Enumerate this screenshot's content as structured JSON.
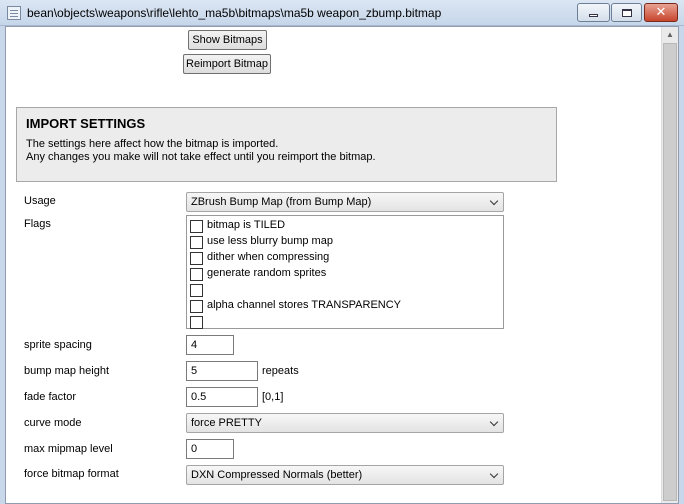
{
  "window": {
    "title": "bean\\objects\\weapons\\rifle\\lehto_ma5b\\bitmaps\\ma5b weapon_zbump.bitmap"
  },
  "buttons": {
    "show_bitmaps": "Show Bitmaps",
    "reimport_bitmap": "Reimport Bitmap"
  },
  "import_settings": {
    "title": "IMPORT SETTINGS",
    "desc_line1": "The settings here affect how the bitmap is imported.",
    "desc_line2": "Any changes you make will not take effect until you reimport the bitmap."
  },
  "fields": {
    "usage": {
      "label": "Usage",
      "value": "ZBrush Bump Map (from Bump Map)"
    },
    "flags": {
      "label": "Flags",
      "items": [
        {
          "label": "bitmap is TILED",
          "checked": false
        },
        {
          "label": "use less blurry bump map",
          "checked": false
        },
        {
          "label": "dither when compressing",
          "checked": false
        },
        {
          "label": "generate random sprites",
          "checked": false
        },
        {
          "label": "",
          "checked": false
        },
        {
          "label": "alpha channel stores TRANSPARENCY",
          "checked": false
        },
        {
          "label": "",
          "checked": false
        }
      ]
    },
    "sprite_spacing": {
      "label": "sprite spacing",
      "value": "4"
    },
    "bump_map_height": {
      "label": "bump map height",
      "value": "5",
      "unit": "repeats"
    },
    "fade_factor": {
      "label": "fade factor",
      "value": "0.5",
      "unit": "[0,1]"
    },
    "curve_mode": {
      "label": "curve mode",
      "value": "force PRETTY"
    },
    "max_mipmap_level": {
      "label": "max mipmap level",
      "value": "0"
    },
    "force_bitmap_format": {
      "label": "force bitmap format",
      "value": "DXN Compressed Normals (better)"
    }
  },
  "icons": {
    "app": "document-icon",
    "minimize": "minimize-icon",
    "maximize": "maximize-icon",
    "close": "close-icon",
    "dropdown": "chevron-down-icon",
    "scroll_up": "scroll-up-arrow-icon"
  },
  "colors": {
    "close_button": "#c7452c",
    "titlebar": "#c6d6ea",
    "panel": "#ececec"
  }
}
